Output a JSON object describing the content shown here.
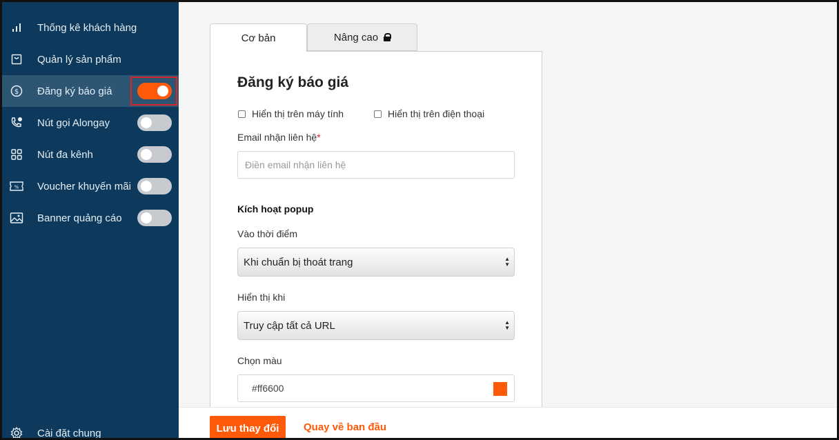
{
  "sidebar": {
    "items": [
      {
        "label": "Thống kê khách hàng",
        "icon": "bar-chart-icon"
      },
      {
        "label": "Quản lý sản phẩm",
        "icon": "shopping-bag-icon"
      },
      {
        "label": "Đăng ký báo giá",
        "icon": "dollar-circle-icon",
        "active": true,
        "toggle": "on"
      },
      {
        "label": "Nút gọi Alongay",
        "icon": "phone-call-icon",
        "toggle": "off"
      },
      {
        "label": "Nút đa kênh",
        "icon": "grid-icon",
        "toggle": "off"
      },
      {
        "label": "Voucher khuyến mãi",
        "icon": "ticket-icon",
        "toggle": "off"
      },
      {
        "label": "Banner quảng cáo",
        "icon": "image-icon",
        "toggle": "off"
      }
    ],
    "settings_label": "Cài đặt chung"
  },
  "tabs": [
    {
      "label": "Cơ bản",
      "active": true
    },
    {
      "label": "Nâng cao",
      "locked": true
    }
  ],
  "form": {
    "title": "Đăng ký báo giá",
    "checkbox_desktop": "Hiển thị trên máy tính",
    "checkbox_mobile": "Hiển thị trên điện thoại",
    "email_label": "Email nhận liên hệ",
    "email_required_mark": "*",
    "email_placeholder": "Điền email nhận liên hệ",
    "section_title": "Kích hoạt popup",
    "timing_label": "Vào thời điểm",
    "timing_value": "Khi chuẩn bị thoát trang",
    "display_label": "Hiển thị khi",
    "display_value": "Truy cập tất cả URL",
    "color_label": "Chọn màu",
    "color_value": "#ff6600"
  },
  "footer": {
    "save_label": "Lưu thay đổi",
    "reset_label": "Quay về ban đầu"
  },
  "colors": {
    "sidebar_bg": "#0d3a5c",
    "accent": "#ff5a0a",
    "highlight_border": "#d8262b"
  }
}
